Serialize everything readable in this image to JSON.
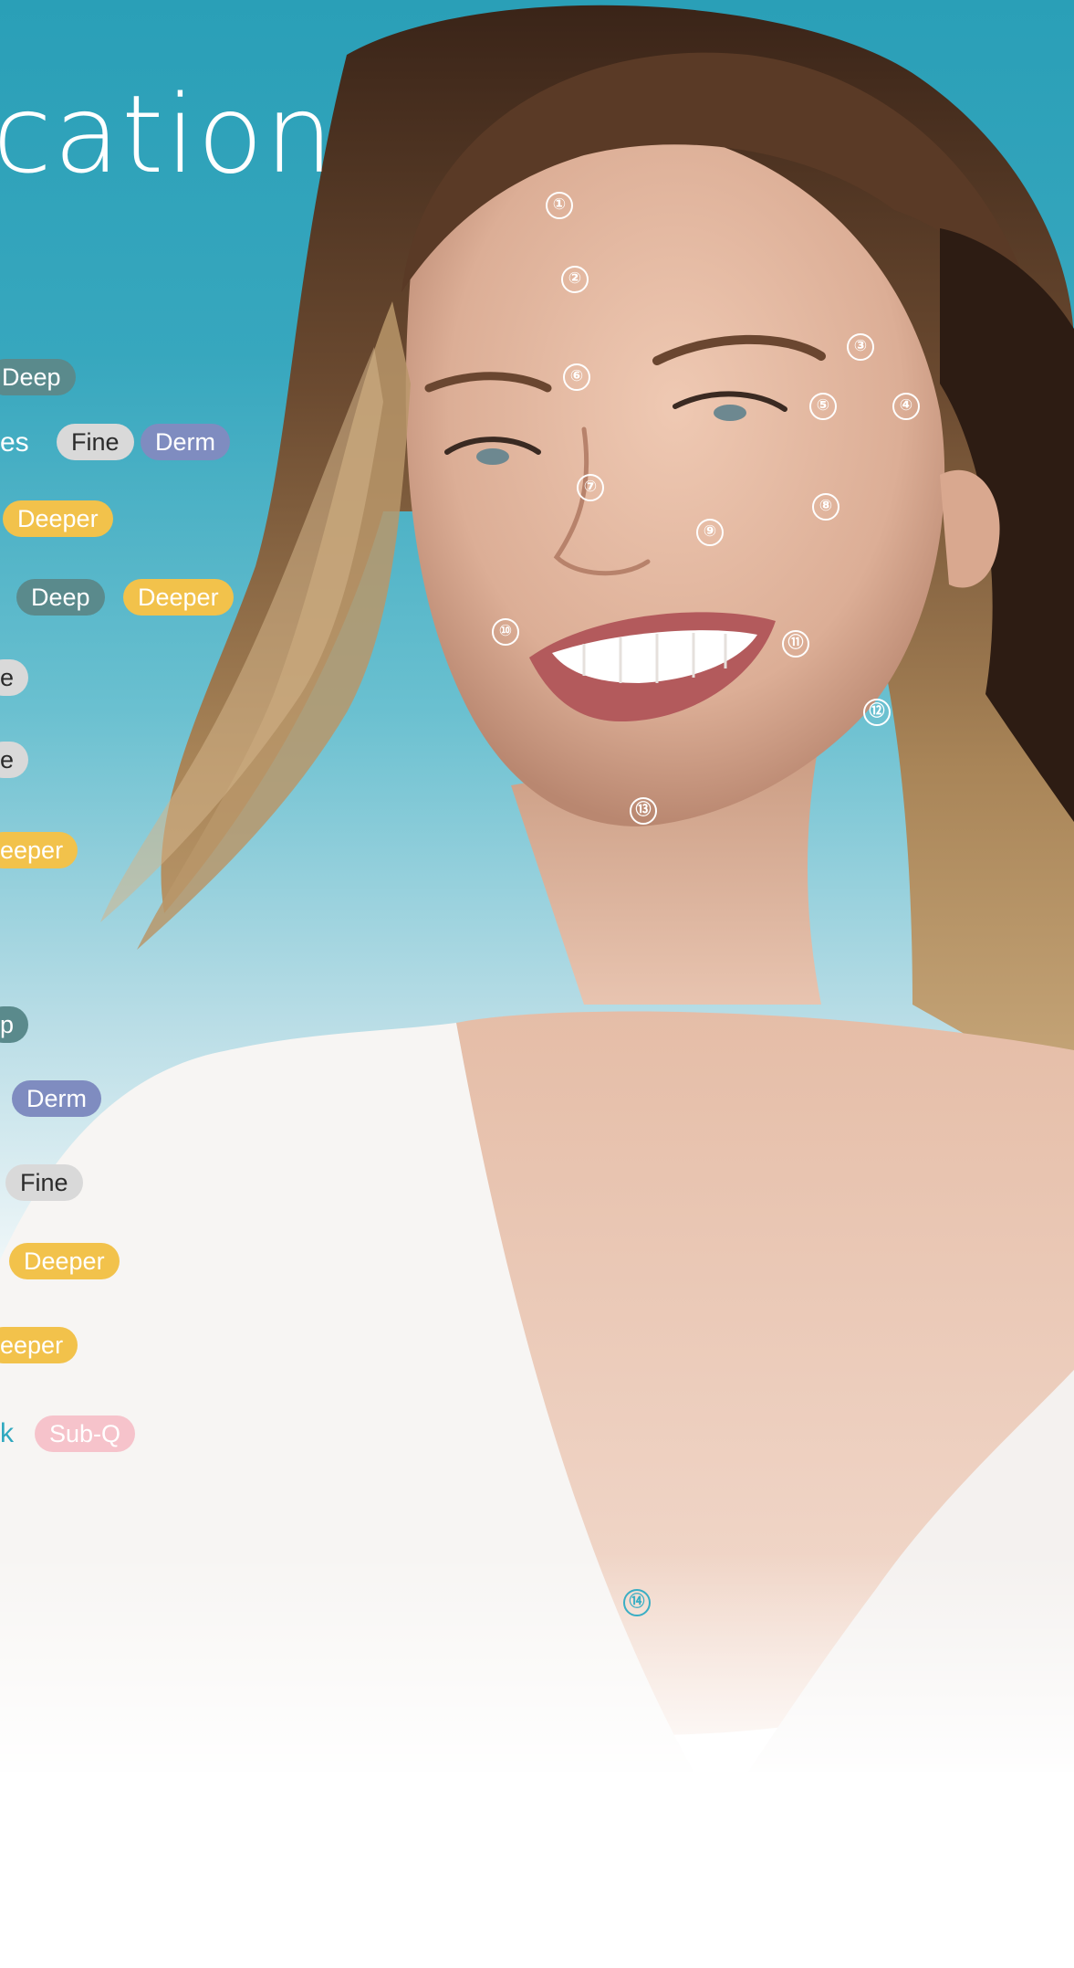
{
  "title": "cation",
  "rows": [
    {
      "text": "es"
    },
    {
      "text": "k"
    }
  ],
  "pills": {
    "deep": "Deep",
    "fine": "Fine",
    "derm": "Derm",
    "deeper": "Deeper",
    "subq": "Sub-Q",
    "clipped_e": "e",
    "clipped_p": "p",
    "clipped_eeper": "eeper"
  },
  "markers": [
    "①",
    "②",
    "③",
    "④",
    "⑤",
    "⑥",
    "⑦",
    "⑧",
    "⑨",
    "⑩",
    "⑪",
    "⑫",
    "⑬",
    "⑭"
  ],
  "colors": {
    "background_top": "#2a9fb7",
    "deep": "#5a8a8c",
    "fine": "#d9d9d9",
    "derm": "#7f8cc0",
    "deeper": "#f2c24b",
    "subq": "#f6c3cb",
    "accent": "#2fa8bf"
  }
}
